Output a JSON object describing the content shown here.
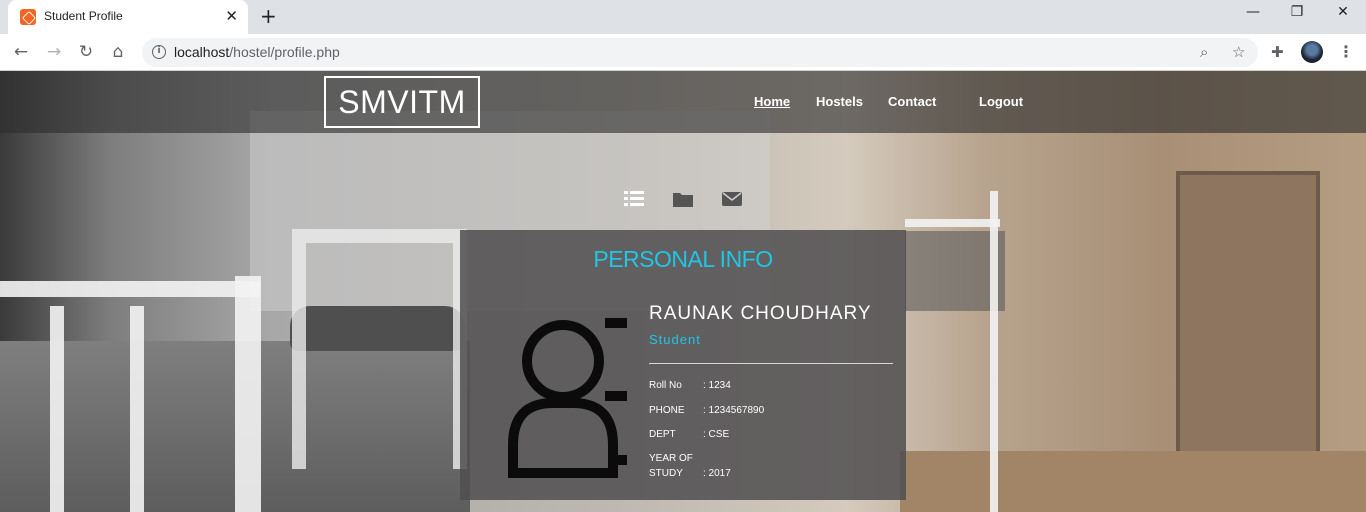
{
  "browser": {
    "tab_title": "Student Profile",
    "tab_close": "✕",
    "new_tab": "+",
    "url_host": "localhost",
    "url_path": "/hostel/profile.php",
    "window_controls": {
      "minimize": "—",
      "maximize": "❐",
      "close": "✕"
    }
  },
  "site": {
    "brand": "SMVITM",
    "nav": [
      {
        "label": "Home",
        "active": true
      },
      {
        "label": "Hostels"
      },
      {
        "label": "Contact"
      },
      {
        "label": "Logout"
      }
    ],
    "icons": [
      "list-icon",
      "folder-icon",
      "envelope-icon"
    ]
  },
  "profile": {
    "section_title": "PERSONAL INFO",
    "name": "RAUNAK CHOUDHARY",
    "role": "Student",
    "fields": [
      {
        "label": "Roll No",
        "value": ": 1234"
      },
      {
        "label": "PHONE",
        "value": ": 1234567890"
      },
      {
        "label": "DEPT",
        "value": ": CSE"
      },
      {
        "label": "YEAR OF",
        "value": ""
      },
      {
        "label": "STUDY",
        "value": ": 2017"
      }
    ]
  },
  "colors": {
    "accent": "#1fc6e6",
    "card_bg": "#504e50",
    "nav_bg": "#2d2d2d"
  }
}
